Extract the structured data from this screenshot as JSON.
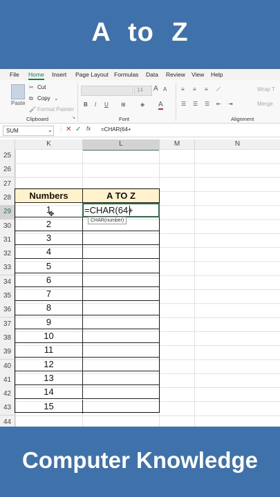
{
  "top_title": "A  to  Z",
  "bottom_title": "Computer Knowledge",
  "menu": [
    "File",
    "Home",
    "Insert",
    "Page Layout",
    "Formulas",
    "Data",
    "Review",
    "View",
    "Help"
  ],
  "ribbon": {
    "paste": "Paste",
    "cut": "Cut",
    "copy": "Copy",
    "format_painter": "Format Painter",
    "clipboard": "Clipboard",
    "font_group": "Font",
    "alignment_group": "Alignment",
    "font_size": "14",
    "wrap": "Wrap T",
    "merge": "Merge"
  },
  "formula_bar": {
    "name_box": "SUM",
    "fx": "fx",
    "formula": "=CHAR(64+"
  },
  "columns": [
    "K",
    "L",
    "M",
    "N"
  ],
  "rows": [
    "25",
    "26",
    "27",
    "28",
    "29",
    "30",
    "31",
    "32",
    "33",
    "34",
    "35",
    "36",
    "37",
    "38",
    "39",
    "40",
    "41",
    "42",
    "43",
    "44"
  ],
  "table": {
    "header_numbers": "Numbers",
    "header_atoz": "A TO Z",
    "numbers": [
      "1",
      "2",
      "3",
      "4",
      "5",
      "6",
      "7",
      "8",
      "9",
      "10",
      "11",
      "12",
      "13",
      "14",
      "15"
    ],
    "editing_text": "=CHAR(64+",
    "tooltip": "CHAR(number)"
  },
  "colors": {
    "banner": "#3f72ab",
    "header_fill": "#fff2cc",
    "active_border": "#217346"
  }
}
